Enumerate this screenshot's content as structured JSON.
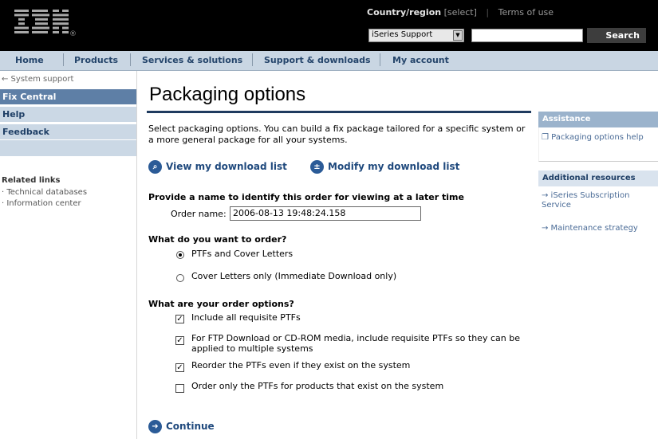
{
  "header": {
    "logo_text": "IBM",
    "country_label": "Country/region",
    "country_select": "[select]",
    "terms_label": "Terms of use",
    "support_select": "iSeries Support",
    "search_button": "Search"
  },
  "nav": [
    "Home",
    "Products",
    "Services & solutions",
    "Support & downloads",
    "My account"
  ],
  "left": {
    "back_link": "← System support",
    "items": [
      "Fix Central",
      "Help",
      "Feedback"
    ],
    "related_title": "Related links",
    "related": [
      "· Technical databases",
      "· Information center"
    ]
  },
  "main": {
    "title": "Packaging options",
    "intro": "Select packaging options. You can build a fix package tailored for a specific system or a more general package for all your systems.",
    "view_download": "View my download list",
    "modify_download": "Modify my download list",
    "name_section": "Provide a name to identify this order for viewing at a later time",
    "order_name_label": "Order name:",
    "order_name_value": "2006-08-13 19:48:24.158",
    "order_section": "What do you want to order?",
    "order_options": [
      {
        "label": "PTFs and Cover Letters",
        "selected": true
      },
      {
        "label": "Cover Letters only (Immediate Download only)",
        "selected": false
      }
    ],
    "options_section": "What are your order options?",
    "checkboxes": [
      {
        "label": "Include all requisite PTFs",
        "checked": true
      },
      {
        "label": "For FTP Download or CD-ROM media, include requisite PTFs so they can be applied to multiple systems",
        "checked": true
      },
      {
        "label": "Reorder the PTFs even if they exist on the system",
        "checked": true
      },
      {
        "label": "Order only the PTFs for products that exist on the system",
        "checked": false
      }
    ],
    "continue": "Continue"
  },
  "right": {
    "assistance_title": "Assistance",
    "assistance_link": "Packaging options help",
    "resources_title": "Additional resources",
    "resources": [
      "→ iSeries Subscription Service",
      "→ Maintenance strategy"
    ]
  }
}
